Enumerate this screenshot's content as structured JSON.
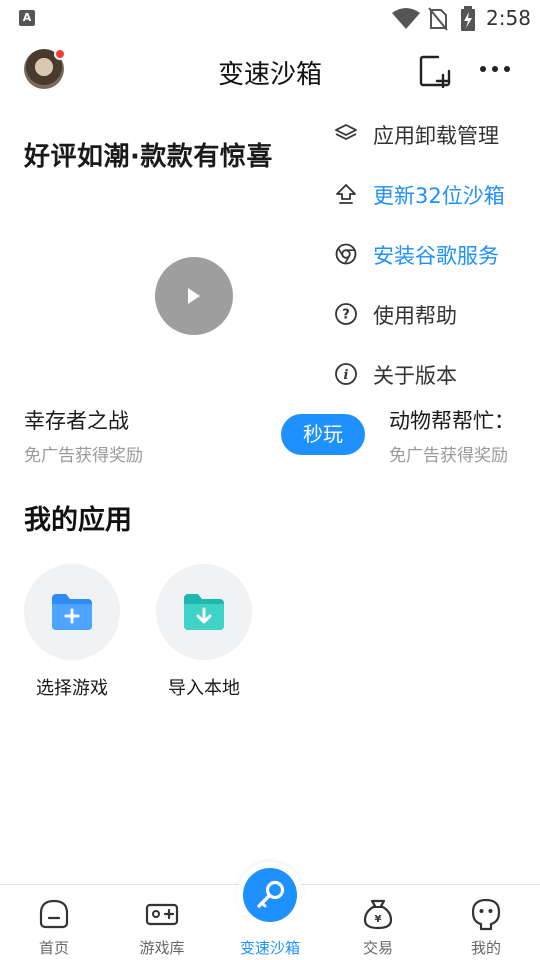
{
  "status_bar": {
    "time": "2:58",
    "notification_icon": "a-icon",
    "indicators": [
      "wifi-icon",
      "no-sim-icon",
      "battery-charging-icon"
    ]
  },
  "header": {
    "title": "变速沙箱",
    "avatar_has_badge": true,
    "actions": [
      "add-square-icon",
      "more-dots-icon"
    ]
  },
  "banner": {
    "title": "好评如潮·款款有惊喜",
    "games": [
      {
        "name": "幸存者之战",
        "subtitle": "免广告获得奖励",
        "action": "秒玩"
      },
      {
        "name": "动物帮帮忙：",
        "subtitle": "免广告获得奖励"
      }
    ]
  },
  "menu": {
    "items": [
      {
        "label": "应用卸载管理",
        "icon": "layers-icon",
        "highlighted": false
      },
      {
        "label": "更新32位沙箱",
        "icon": "upload-icon",
        "highlighted": true
      },
      {
        "label": "安装谷歌服务",
        "icon": "chrome-icon",
        "highlighted": true
      },
      {
        "label": "使用帮助",
        "icon": "help-circle-icon",
        "highlighted": false
      },
      {
        "label": "关于版本",
        "icon": "info-circle-icon",
        "highlighted": false
      }
    ]
  },
  "my_apps": {
    "title": "我的应用",
    "items": [
      {
        "label": "选择游戏",
        "icon": "folder-add-icon"
      },
      {
        "label": "导入本地",
        "icon": "folder-import-icon"
      }
    ]
  },
  "bottom_nav": {
    "items": [
      {
        "label": "首页",
        "icon": "home-icon",
        "active": false
      },
      {
        "label": "游戏库",
        "icon": "gamepad-icon",
        "active": false
      },
      {
        "label": "变速沙箱",
        "icon": "key-icon",
        "active": true
      },
      {
        "label": "交易",
        "icon": "money-bag-icon",
        "active": false
      },
      {
        "label": "我的",
        "icon": "profile-icon",
        "active": false
      }
    ]
  },
  "colors": {
    "accent": "#1E90FF",
    "text_primary": "#1A1A1A",
    "text_secondary": "#9A9A9A",
    "nav_inactive": "#666666",
    "badge": "#FF3B30"
  }
}
